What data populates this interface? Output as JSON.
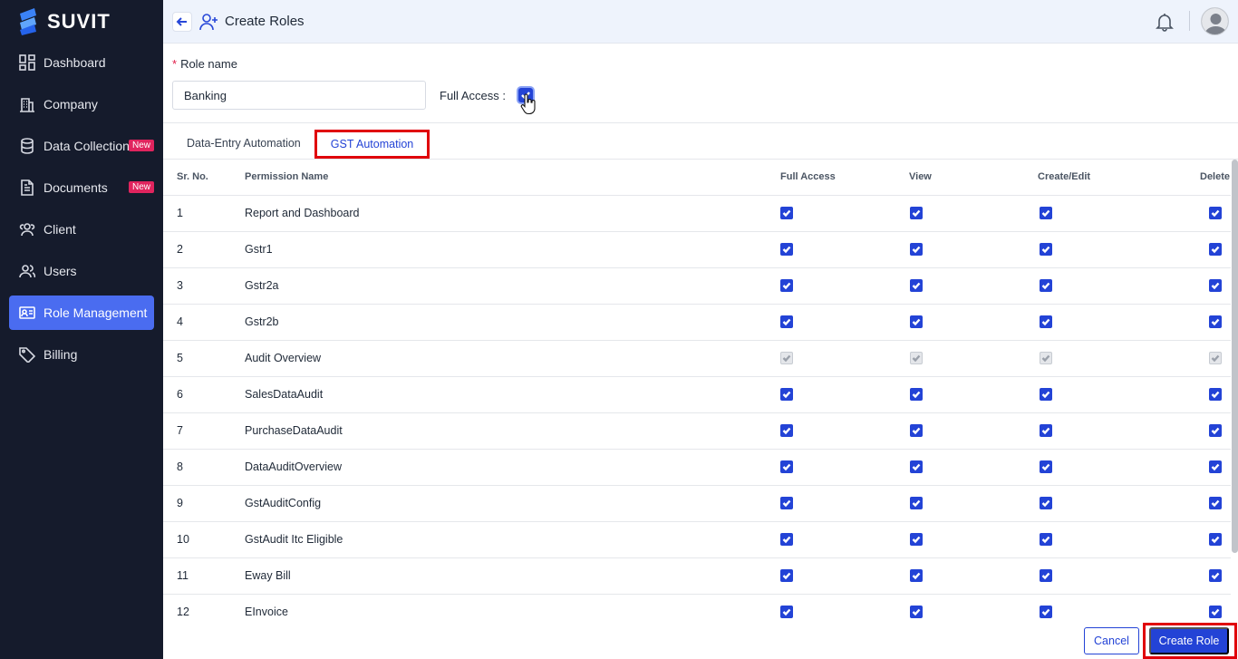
{
  "app": {
    "brand": "SUVIT"
  },
  "sidebar": {
    "items": [
      {
        "label": "Dashboard",
        "icon": "dashboard-grid-icon"
      },
      {
        "label": "Company",
        "icon": "building-icon"
      },
      {
        "label": "Data Collection",
        "icon": "database-icon",
        "badge": "New"
      },
      {
        "label": "Documents",
        "icon": "document-icon",
        "badge": "New"
      },
      {
        "label": "Client",
        "icon": "client-people-icon"
      },
      {
        "label": "Users",
        "icon": "users-icon"
      },
      {
        "label": "Role Management",
        "icon": "id-card-icon",
        "active": true
      },
      {
        "label": "Billing",
        "icon": "tag-icon"
      }
    ]
  },
  "header": {
    "title": "Create Roles"
  },
  "form": {
    "role_label": "Role name",
    "required_mark": "*",
    "role_value": "Banking",
    "full_access_label": "Full Access :",
    "full_access_checked": true
  },
  "tabs": [
    {
      "label": "Data-Entry Automation",
      "active": false
    },
    {
      "label": "GST Automation",
      "active": true
    }
  ],
  "table": {
    "headers": {
      "sr": "Sr. No.",
      "name": "Permission Name",
      "full_access": "Full Access",
      "view": "View",
      "create_edit": "Create/Edit",
      "delete": "Delete"
    },
    "rows": [
      {
        "sr": "1",
        "name": "Report and Dashboard",
        "disabled": false
      },
      {
        "sr": "2",
        "name": "Gstr1",
        "disabled": false
      },
      {
        "sr": "3",
        "name": "Gstr2a",
        "disabled": false
      },
      {
        "sr": "4",
        "name": "Gstr2b",
        "disabled": false
      },
      {
        "sr": "5",
        "name": "Audit Overview",
        "disabled": true
      },
      {
        "sr": "6",
        "name": "SalesDataAudit",
        "disabled": false
      },
      {
        "sr": "7",
        "name": "PurchaseDataAudit",
        "disabled": false
      },
      {
        "sr": "8",
        "name": "DataAuditOverview",
        "disabled": false
      },
      {
        "sr": "9",
        "name": "GstAuditConfig",
        "disabled": false
      },
      {
        "sr": "10",
        "name": "GstAudit Itc Eligible",
        "disabled": false
      },
      {
        "sr": "11",
        "name": "Eway Bill",
        "disabled": false
      },
      {
        "sr": "12",
        "name": "EInvoice",
        "disabled": false
      }
    ]
  },
  "footer": {
    "cancel_label": "Cancel",
    "create_label": "Create Role"
  },
  "colors": {
    "sidebar_bg": "#151b2c",
    "accent": "#2343d6",
    "active_nav": "#4a6cf0",
    "highlight": "#e0000b"
  }
}
